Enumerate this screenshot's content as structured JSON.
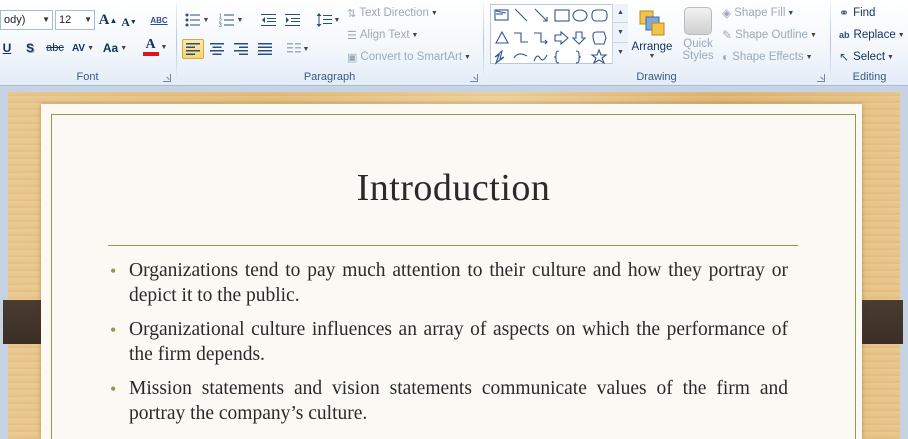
{
  "ribbon": {
    "font": {
      "label": "Font",
      "font_name": "ody)",
      "font_size": "12",
      "grow_icon": "A",
      "shrink_icon": "A",
      "clear_icon": "ABC",
      "underline": "U",
      "shadow": "S",
      "strike": "abc",
      "spacing": "AV",
      "case": "Aa",
      "color": "A",
      "font_color_hex": "#e0141e"
    },
    "paragraph": {
      "label": "Paragraph",
      "text_direction": "Text Direction",
      "align_text": "Align Text",
      "convert_smartart": "Convert to SmartArt"
    },
    "drawing": {
      "label": "Drawing",
      "arrange": "Arrange",
      "quick_styles_line1": "Quick",
      "quick_styles_line2": "Styles",
      "shape_fill": "Shape Fill",
      "shape_outline": "Shape Outline",
      "shape_effects": "Shape Effects"
    },
    "editing": {
      "label": "Editing",
      "find": "Find",
      "replace": "Replace",
      "select": "Select"
    }
  },
  "slide": {
    "title": "Introduction",
    "bullets": [
      "Organizations tend to pay much attention to their culture and how they portray or depict it to the public.",
      "Organizational culture influences an array of aspects on which the performance of the firm depends.",
      "Mission statements and vision statements communicate values of the firm and portray the company’s culture."
    ]
  }
}
